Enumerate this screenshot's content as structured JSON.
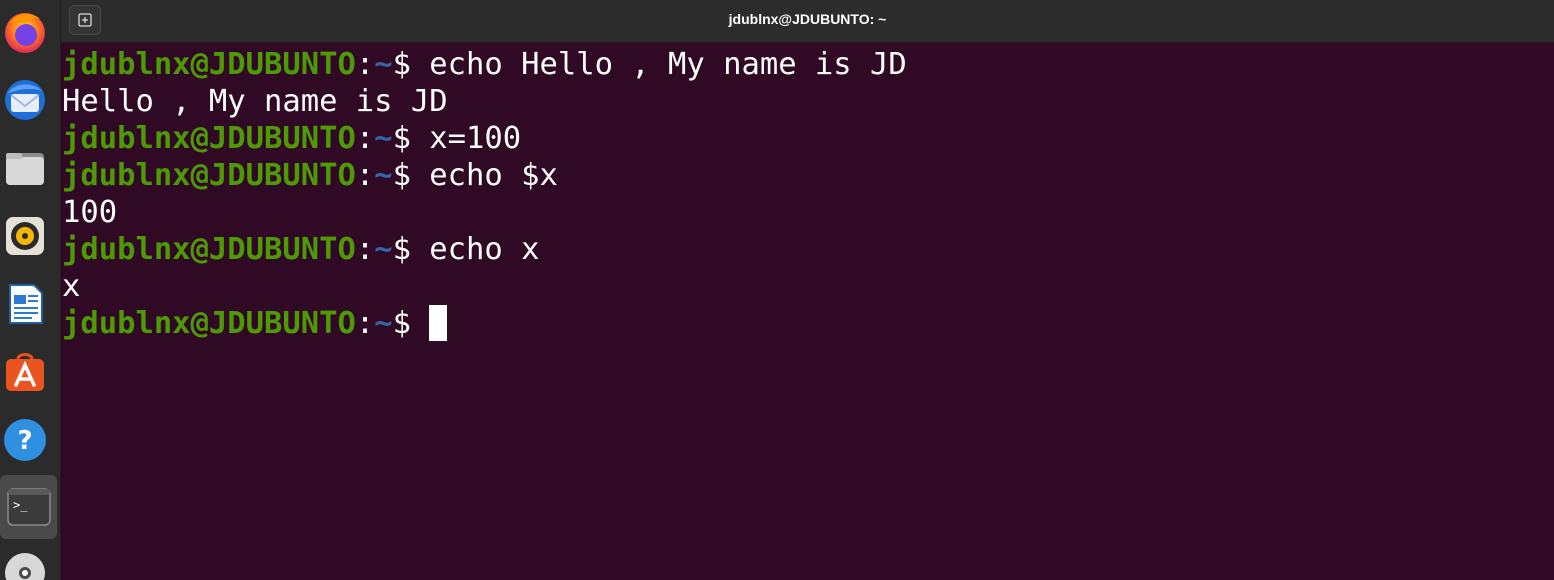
{
  "window": {
    "title": "jdublnx@JDUBUNTO: ~"
  },
  "dock": {
    "items": [
      {
        "icon": "firefox-icon"
      },
      {
        "icon": "thunderbird-icon"
      },
      {
        "icon": "files-icon"
      },
      {
        "icon": "rhythmbox-icon"
      },
      {
        "icon": "libreoffice-writer-icon"
      },
      {
        "icon": "software-center-icon"
      },
      {
        "icon": "help-icon",
        "glyph": "?"
      },
      {
        "icon": "terminal-icon",
        "glyph": ">_"
      },
      {
        "icon": "dvd-icon"
      }
    ]
  },
  "prompt": {
    "user_host": "jdublnx@JDUBUNTO",
    "colon": ":",
    "path": "~",
    "symbol": "$"
  },
  "terminal": {
    "lines": [
      {
        "type": "prompt",
        "command": " echo Hello , My name is JD"
      },
      {
        "type": "output",
        "text": "Hello , My name is JD"
      },
      {
        "type": "prompt",
        "command": " x=100"
      },
      {
        "type": "prompt",
        "command": " echo $x"
      },
      {
        "type": "output",
        "text": "100"
      },
      {
        "type": "prompt",
        "command": " echo x"
      },
      {
        "type": "output",
        "text": "x"
      },
      {
        "type": "prompt",
        "command": " "
      }
    ]
  },
  "colors": {
    "background": "#300a24",
    "user_host": "#4e9a06",
    "path": "#3465a4",
    "text": "#ffffff"
  }
}
